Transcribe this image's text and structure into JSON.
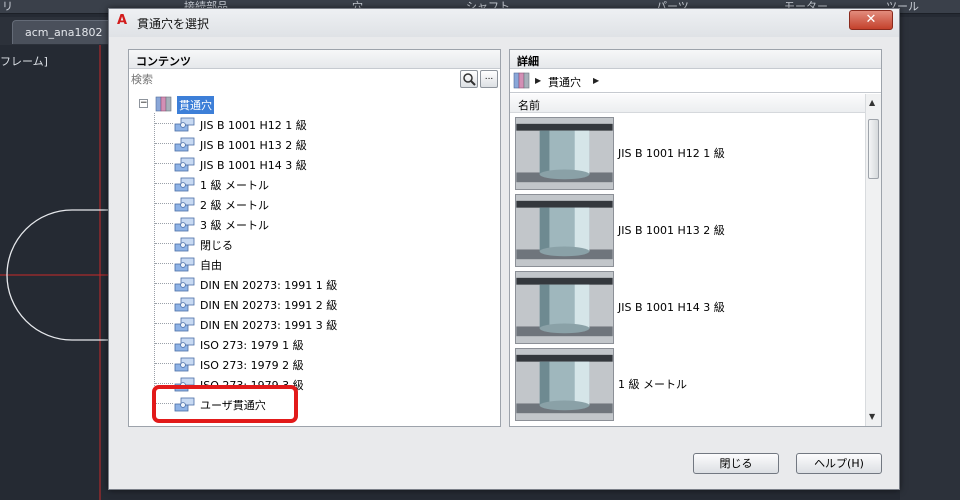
{
  "background": {
    "ribbon_items": [
      "リ",
      "接続部品",
      "穴",
      "シャフト",
      "パーツ",
      "モーター",
      "ツール"
    ],
    "document_tab": "acm_ana1802",
    "left_label": "フレーム]"
  },
  "dialog": {
    "title": "貫通穴を選択",
    "close_glyph": "✕",
    "contents": {
      "header": "コンテンツ",
      "search_placeholder": "検索",
      "more_button": "...",
      "root_expander": "−",
      "root_label": "貫通穴",
      "items": [
        "JIS B 1001 H12 1 級",
        "JIS B 1001 H13 2 級",
        "JIS B 1001 H14 3 級",
        "1 級 メートル",
        "2 級 メートル",
        "3 級 メートル",
        "閉じる",
        "自由",
        "DIN EN 20273: 1991 1 級",
        "DIN EN 20273: 1991 2 級",
        "DIN EN 20273: 1991 3 級",
        "ISO 273: 1979 1 級",
        "ISO 273: 1979 2 級",
        "ISO 273: 1979 3 級",
        "ユーザ貫通穴"
      ]
    },
    "details": {
      "header": "詳細",
      "breadcrumb": "貫通穴",
      "column_name": "名前",
      "rows": [
        "JIS B 1001 H12 1 級",
        "JIS B 1001 H13 2 級",
        "JIS B 1001 H14 3 級",
        "1 級 メートル"
      ]
    },
    "buttons": {
      "close": "閉じる",
      "help": "ヘルプ(H)"
    }
  },
  "colors": {
    "highlight": "#e21a1a",
    "selection": "#3d7fd8",
    "app_icon": "#d21c1c"
  }
}
